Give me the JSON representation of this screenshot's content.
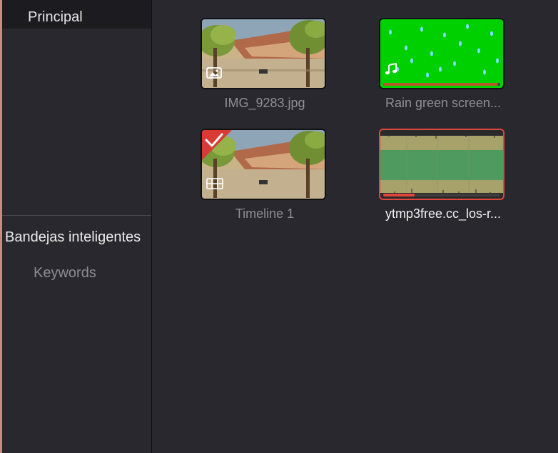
{
  "sidebar": {
    "bins": [
      {
        "label": "Principal",
        "selected": true
      }
    ],
    "smart_bins_title": "Bandejas inteligentes",
    "smart_bins": [
      {
        "label": "Keywords"
      }
    ]
  },
  "media_pool": {
    "clips": [
      {
        "name": "IMG_9283.jpg",
        "type": "still-image",
        "type_icon": "image-icon",
        "selected": false,
        "label_style": "dim"
      },
      {
        "name": "Rain green screen...",
        "type": "video-with-audio",
        "type_icon": "music-note-icon",
        "selected": false,
        "label_style": "dim",
        "progress_fraction": 0.98,
        "progress_color": "#b25a2a"
      },
      {
        "name": "Timeline 1",
        "type": "timeline",
        "type_icon": "timeline-icon",
        "selected": false,
        "label_style": "dim",
        "checked": true,
        "check_color": "#d93a33"
      },
      {
        "name": "ytmp3free.cc_los-r...",
        "type": "audio",
        "type_icon": "waveform",
        "selected": true,
        "label_style": "bright",
        "progress_fraction": 0.27,
        "progress_color": "#e0473c"
      }
    ]
  },
  "colors": {
    "background": "#28282e",
    "sidebar_selected_bg": "#1c1c20",
    "selection_border": "#e0473c",
    "green_screen": "#00d000",
    "audio_green": "#4f9b5f",
    "audio_khaki": "#a6a26a"
  }
}
